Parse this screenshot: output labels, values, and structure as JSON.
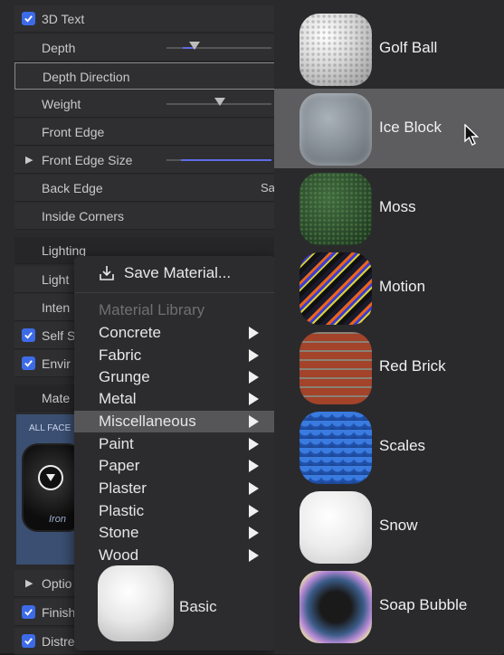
{
  "inspector": {
    "text3d_label": "3D Text",
    "depth_label": "Depth",
    "depth_direction_label": "Depth Direction",
    "weight_label": "Weight",
    "front_edge_label": "Front Edge",
    "front_edge_size_label": "Front Edge Size",
    "back_edge_label": "Back Edge",
    "back_edge_value": "Sa",
    "inside_corners_label": "Inside Corners",
    "lighting_label": "Lighting",
    "light_label": "Light",
    "intensity_label": "Inten",
    "self_shadows_label": "Self S",
    "environment_label": "Envir",
    "material_label": "Mate",
    "all_faces_label": "ALL FACE",
    "preview_material": "Iron",
    "options_label": "Optio",
    "finish_label": "Finish",
    "distress_label": "Distre"
  },
  "menu": {
    "save_label": "Save Material...",
    "library_header": "Material Library",
    "items": [
      {
        "label": "Concrete"
      },
      {
        "label": "Fabric"
      },
      {
        "label": "Grunge"
      },
      {
        "label": "Metal"
      },
      {
        "label": "Miscellaneous",
        "selected": true
      },
      {
        "label": "Paint"
      },
      {
        "label": "Paper"
      },
      {
        "label": "Plaster"
      },
      {
        "label": "Plastic"
      },
      {
        "label": "Stone"
      },
      {
        "label": "Wood"
      }
    ],
    "basic_label": "Basic"
  },
  "submenu": {
    "items": [
      {
        "label": "Golf Ball"
      },
      {
        "label": "Ice Block",
        "selected": true
      },
      {
        "label": "Moss"
      },
      {
        "label": "Motion"
      },
      {
        "label": "Red Brick"
      },
      {
        "label": "Scales"
      },
      {
        "label": "Snow"
      },
      {
        "label": "Soap Bubble"
      }
    ]
  },
  "colors": {
    "checkbox": "#3d6be8",
    "slider_fill": "#5d6ce6",
    "menu_selection": "#565659",
    "submenu_selection": "#5d5d60"
  },
  "icons": {
    "save": "save-material-icon",
    "submenu_arrow": "submenu-arrow-icon",
    "cursor": "mouse-pointer-icon"
  }
}
